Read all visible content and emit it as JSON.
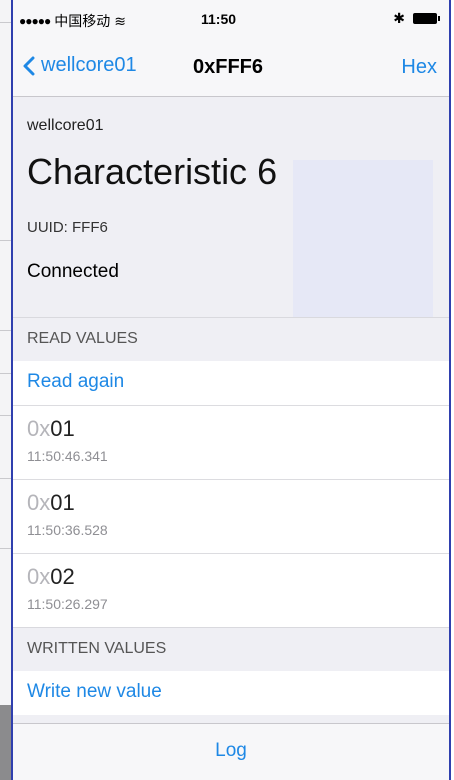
{
  "status_bar": {
    "signal_dots": "●●●●●",
    "carrier": "中国移动",
    "wifi_glyph": "≋",
    "time": "11:50",
    "bluetooth_glyph": "✱"
  },
  "nav": {
    "back_label": "wellcore01",
    "title": "0xFFF6",
    "hex_label": "Hex"
  },
  "header": {
    "device_name": "wellcore01",
    "characteristic_title": "Characteristic 6",
    "uuid": "UUID: FFF6",
    "connection_status": "Connected"
  },
  "read_section": {
    "title": "READ VALUES",
    "action_label": "Read again",
    "values": [
      {
        "prefix": "0x",
        "digits": "01",
        "timestamp": "11:50:46.341"
      },
      {
        "prefix": "0x",
        "digits": "01",
        "timestamp": "11:50:36.528"
      },
      {
        "prefix": "0x",
        "digits": "02",
        "timestamp": "11:50:26.297"
      }
    ]
  },
  "write_section": {
    "title": "WRITTEN VALUES",
    "action_label": "Write new value"
  },
  "tab_bar": {
    "log_label": "Log"
  },
  "colors": {
    "accent": "#1e88e5",
    "background": "#efeff4",
    "frame_border": "#2f3fae"
  },
  "icons": [
    "signal-dots-icon",
    "wifi-icon",
    "bluetooth-icon",
    "battery-icon",
    "back-chevron-icon"
  ]
}
